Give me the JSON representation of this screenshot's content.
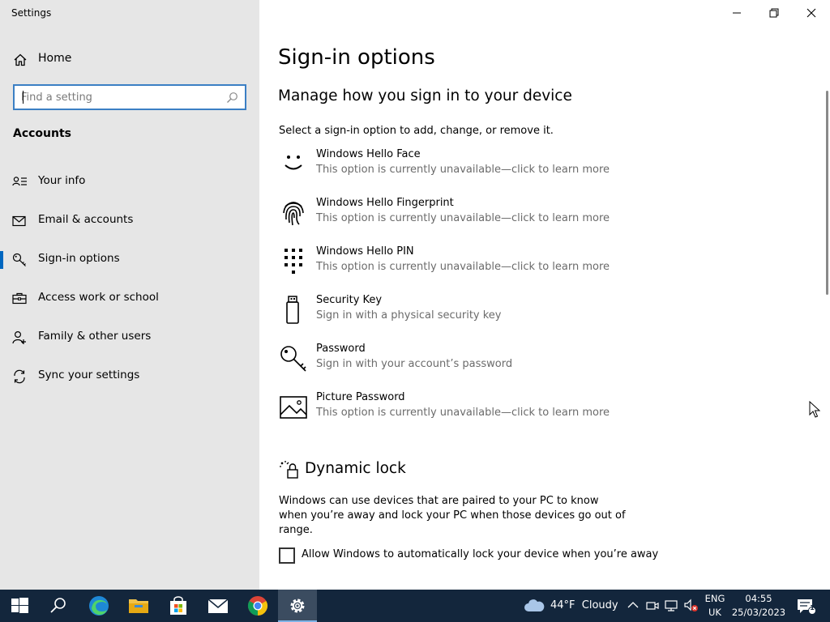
{
  "window": {
    "title": "Settings"
  },
  "sidebar": {
    "home_label": "Home",
    "search_placeholder": "Find a setting",
    "section_heading": "Accounts",
    "items": [
      {
        "label": "Your info",
        "icon": "person-card-icon",
        "active": false
      },
      {
        "label": "Email & accounts",
        "icon": "mail-icon",
        "active": false
      },
      {
        "label": "Sign-in options",
        "icon": "key-icon",
        "active": true
      },
      {
        "label": "Access work or school",
        "icon": "briefcase-icon",
        "active": false
      },
      {
        "label": "Family & other users",
        "icon": "people-icon",
        "active": false
      },
      {
        "label": "Sync your settings",
        "icon": "sync-icon",
        "active": false
      }
    ]
  },
  "main": {
    "title": "Sign-in options",
    "subheading": "Manage how you sign in to your device",
    "intro": "Select a sign-in option to add, change, or remove it.",
    "options": [
      {
        "title": "Windows Hello Face",
        "desc": "This option is currently unavailable—click to learn more",
        "icon": "face-icon"
      },
      {
        "title": "Windows Hello Fingerprint",
        "desc": "This option is currently unavailable—click to learn more",
        "icon": "fingerprint-icon"
      },
      {
        "title": "Windows Hello PIN",
        "desc": "This option is currently unavailable—click to learn more",
        "icon": "pin-keypad-icon"
      },
      {
        "title": "Security Key",
        "desc": "Sign in with a physical security key",
        "icon": "usb-key-icon"
      },
      {
        "title": "Password",
        "desc": "Sign in with your account’s password",
        "icon": "password-key-icon"
      },
      {
        "title": "Picture Password",
        "desc": "This option is currently unavailable—click to learn more",
        "icon": "picture-icon"
      }
    ],
    "dynamic_lock": {
      "heading": "Dynamic lock",
      "desc": "Windows can use devices that are paired to your PC to know when you’re away and lock your PC when those devices go out of range.",
      "checkbox_label": "Allow Windows to automatically lock your device when you’re away",
      "checked": false
    }
  },
  "taskbar": {
    "weather": "44°F  Cloudy",
    "lang_top": "ENG",
    "lang_bottom": "UK",
    "time": "04:55",
    "date": "25/03/2023",
    "notification_count": "1"
  },
  "colors": {
    "accent": "#0067c0",
    "sidebar_bg": "#e6e6e6",
    "taskbar_bg": "#13263c",
    "desc_text": "#6b6b6b"
  }
}
